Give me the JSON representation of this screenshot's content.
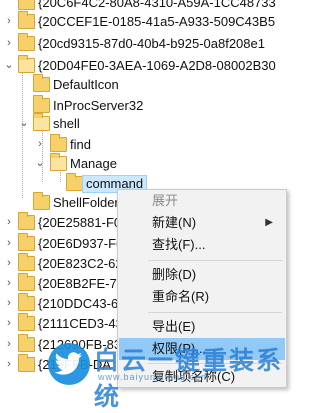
{
  "tree": {
    "top_rows": [
      "{20C6F4C2-80A8-4310-A59A-1CC48733",
      "{20CCEF1E-0185-41a5-A933-509C43B5",
      "{20cd9315-87d0-40b4-b925-0a8f208e1"
    ],
    "expanded_key": "{20D04FE0-3AEA-1069-A2D8-08002B30",
    "children": {
      "default_icon": "DefaultIcon",
      "inproc": "InProcServer32",
      "shell": "shell",
      "find": "find",
      "manage": "Manage",
      "command": "command",
      "shellfolder": "ShellFolder"
    },
    "bottom_rows": [
      "{20E25881-F0",
      "{20E6D937-F6",
      "{20E823C2-62",
      "{20E8B2FE-75",
      "{210DDC43-68",
      "{2111CED3-43",
      "{212690FB-83",
      "{215FFB-DA"
    ]
  },
  "context_menu": {
    "expand": "展开",
    "new": "新建(N)",
    "find": "查找(F)...",
    "delete": "删除(D)",
    "rename": "重命名(R)",
    "export": "导出(E)",
    "permissions": "权限(P)...",
    "copy_key_name": "复制项名称(C)"
  },
  "watermark": {
    "text": "白云一键重装系统",
    "url": "www.baiyunxitong.com"
  },
  "colors": {
    "selection": "#cce8ff",
    "menu_highlight": "#91c9f7",
    "folder": "#f6d06a",
    "watermark_blue": "#2a7fd6"
  }
}
